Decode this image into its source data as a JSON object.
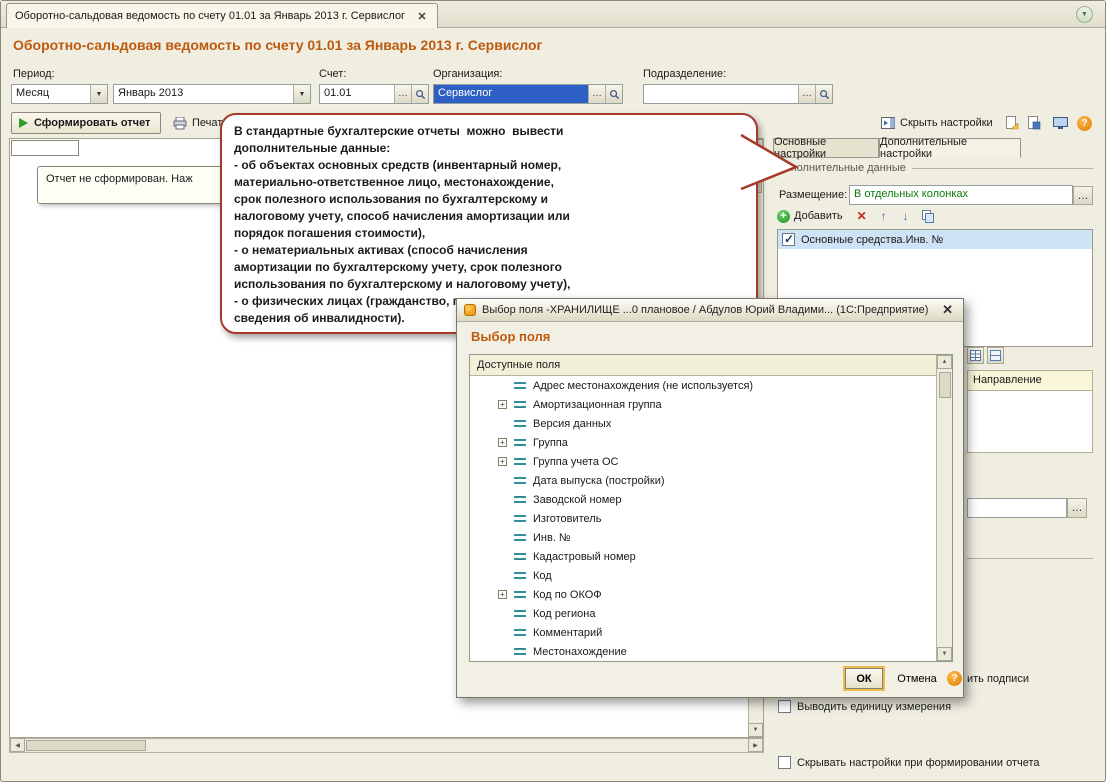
{
  "tabbar": {
    "tab_title": "Оборотно-сальдовая ведомость по счету 01.01 за Январь 2013 г. Сервислог"
  },
  "header": {
    "title": "Оборотно-сальдовая ведомость по счету 01.01 за Январь 2013 г. Сервислог"
  },
  "filters": {
    "period_label": "Период:",
    "period_type_value": "Месяц",
    "period_value": "Январь 2013",
    "account_label": "Счет:",
    "account_value": "01.01",
    "organization_label": "Организация:",
    "organization_value": "Сервислог",
    "department_label": "Подразделение:",
    "department_value": ""
  },
  "toolbar": {
    "generate_button": "Сформировать отчет",
    "print_button": "Печать",
    "hide_settings_button": "Скрыть настройки"
  },
  "report": {
    "not_generated_message": "Отчет не сформирован. Наж"
  },
  "callout": {
    "lines": [
      "В стандартные бухгалтерские отчеты  можно  вывести",
      "дополнительные данные:",
      "- об объектах основных средств (инвентарный номер,",
      "материально-ответственное лицо, местонахождение,",
      "срок полезного использования по бухгалтерскому и",
      "налоговому учету, способ начисления амортизации или",
      "порядок погашения стоимости),",
      "- о нематериальных активах (способ начисления",
      "амортизации по бухгалтерскому учету, срок полезного",
      "использования по бухгалтерскому и налоговому учету),",
      "- о физических лицах (гражданство, паспортные данные,",
      "сведения об инвалидности)."
    ]
  },
  "settings": {
    "tabs": [
      {
        "label": "Основные настройки",
        "active": false
      },
      {
        "label": "Дополнительные настройки",
        "active": true
      }
    ],
    "group_title": "Дополнительные данные",
    "placement_label": "Размещение:",
    "placement_value": "В отдельных колонках",
    "add_button": "Добавить",
    "fields": [
      {
        "label": "Основные средства.Инв. №",
        "checked": true
      }
    ],
    "direction_header": "Направление",
    "signatures_fragment": "ить подписи",
    "unit_checkbox_label": "Выводить единицу измерения",
    "hide_settings_checkbox_label": "Скрывать настройки при формировании отчета"
  },
  "dialog": {
    "title": "Выбор поля -ХРАНИЛИЩЕ ...0 плановое / Абдулов Юрий Владими...  (1С:Предприятие)",
    "heading": "Выбор поля",
    "list_header": "Доступные поля",
    "items": [
      {
        "label": "Адрес местонахождения (не используется)",
        "expandable": false
      },
      {
        "label": "Амортизационная группа",
        "expandable": true
      },
      {
        "label": "Версия данных",
        "expandable": false
      },
      {
        "label": "Группа",
        "expandable": true
      },
      {
        "label": "Группа учета ОС",
        "expandable": true
      },
      {
        "label": "Дата выпуска (постройки)",
        "expandable": false
      },
      {
        "label": "Заводской номер",
        "expandable": false
      },
      {
        "label": "Изготовитель",
        "expandable": false
      },
      {
        "label": "Инв. №",
        "expandable": false
      },
      {
        "label": "Кадастровый номер",
        "expandable": false
      },
      {
        "label": "Код",
        "expandable": false
      },
      {
        "label": "Код по ОКОФ",
        "expandable": true
      },
      {
        "label": "Код региона",
        "expandable": false
      },
      {
        "label": "Комментарий",
        "expandable": false
      },
      {
        "label": "Местонахождение",
        "expandable": false
      }
    ],
    "ok_button": "ОК",
    "cancel_button": "Отмена"
  },
  "colors": {
    "title_orange": "#bd5a0e",
    "selection_blue": "#2e5fc4",
    "balloon_border": "#a53a2a",
    "row_selection": "#cfe3f7"
  }
}
